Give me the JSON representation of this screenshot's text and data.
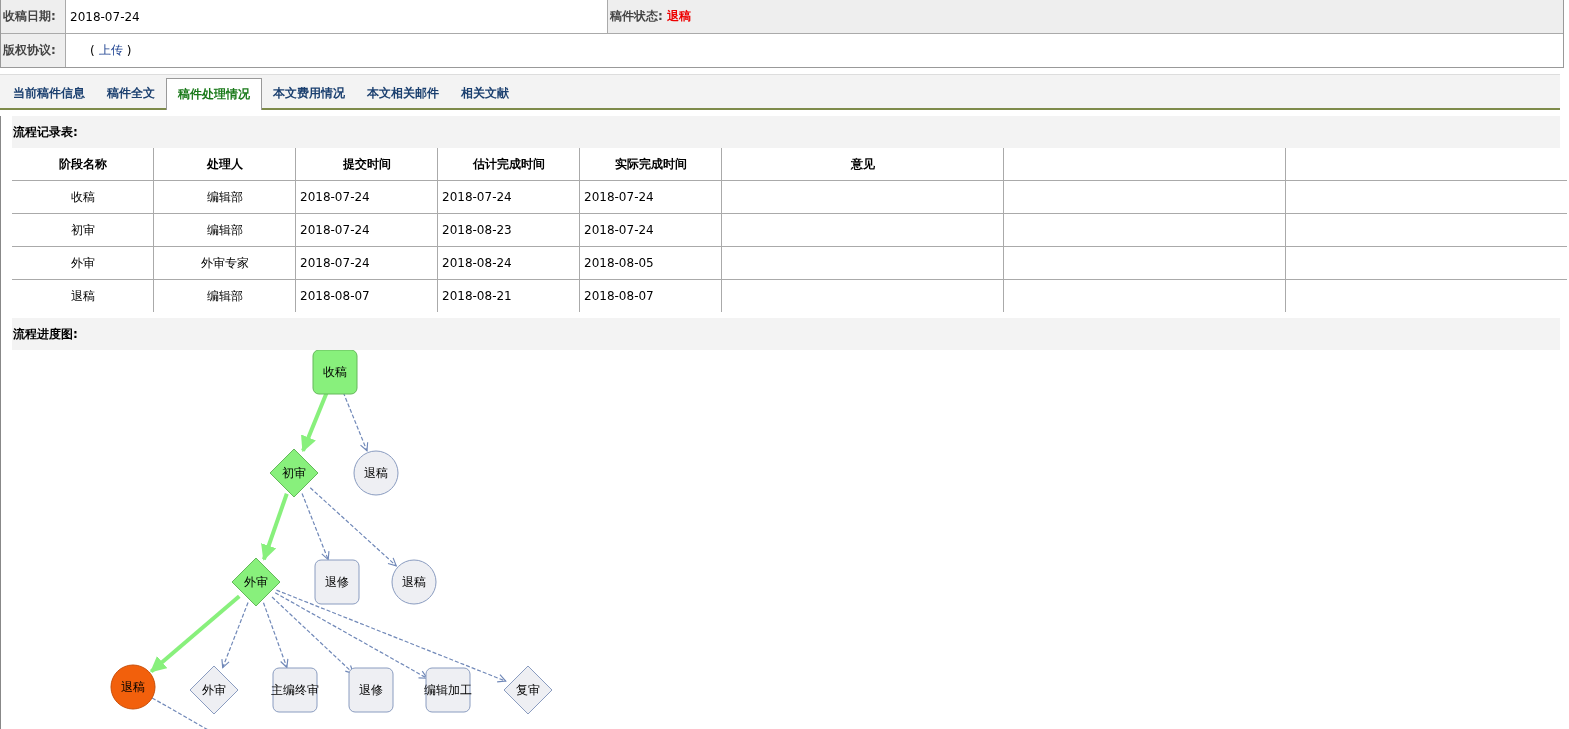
{
  "info": {
    "received_label": "收稿日期:",
    "received_date": "2018-07-24",
    "status_label": "稿件状态:",
    "status": "退稿",
    "copyright_label": "版权协议:",
    "copyright_open": "(",
    "upload_link": "上传",
    "copyright_close": ")"
  },
  "tabs": [
    {
      "label": "当前稿件信息",
      "selected": false
    },
    {
      "label": "稿件全文",
      "selected": false
    },
    {
      "label": "稿件处理情况",
      "selected": true
    },
    {
      "label": "本文费用情况",
      "selected": false
    },
    {
      "label": "本文相关邮件",
      "selected": false
    },
    {
      "label": "相关文献",
      "selected": false
    }
  ],
  "record_table": {
    "title": "流程记录表:",
    "columns": [
      "阶段名称",
      "处理人",
      "提交时间",
      "估计完成时间",
      "实际完成时间",
      "意见"
    ],
    "rows": [
      [
        "收稿",
        "编辑部",
        "2018-07-24",
        "2018-07-24",
        "2018-07-24"
      ],
      [
        "初审",
        "编辑部",
        "2018-07-24",
        "2018-08-23",
        "2018-07-24"
      ],
      [
        "外审",
        "外审专家",
        "2018-07-24",
        "2018-08-24",
        "2018-08-05"
      ],
      [
        "退稿",
        "编辑部",
        "2018-08-07",
        "2018-08-21",
        "2018-08-07"
      ]
    ]
  },
  "flow_chart": {
    "title": "流程进度图:",
    "nodes": [
      {
        "label": "收稿",
        "kind": "box",
        "done": true,
        "current": false
      },
      {
        "label": "初审",
        "kind": "diamond",
        "done": true,
        "current": false
      },
      {
        "label": "退稿",
        "kind": "circle",
        "done": false,
        "current": false
      },
      {
        "label": "外审",
        "kind": "diamond",
        "done": true,
        "current": false
      },
      {
        "label": "退修",
        "kind": "box",
        "done": false,
        "current": false
      },
      {
        "label": "退稿",
        "kind": "circle",
        "done": false,
        "current": false
      },
      {
        "label": "退稿",
        "kind": "circle",
        "done": false,
        "current": true
      },
      {
        "label": "外审",
        "kind": "diamond",
        "done": false,
        "current": false
      },
      {
        "label": "主编终审",
        "kind": "box",
        "done": false,
        "current": false
      },
      {
        "label": "退修",
        "kind": "box",
        "done": false,
        "current": false
      },
      {
        "label": "编辑加工",
        "kind": "box",
        "done": false,
        "current": false
      },
      {
        "label": "复审",
        "kind": "diamond",
        "done": false,
        "current": false
      }
    ]
  }
}
